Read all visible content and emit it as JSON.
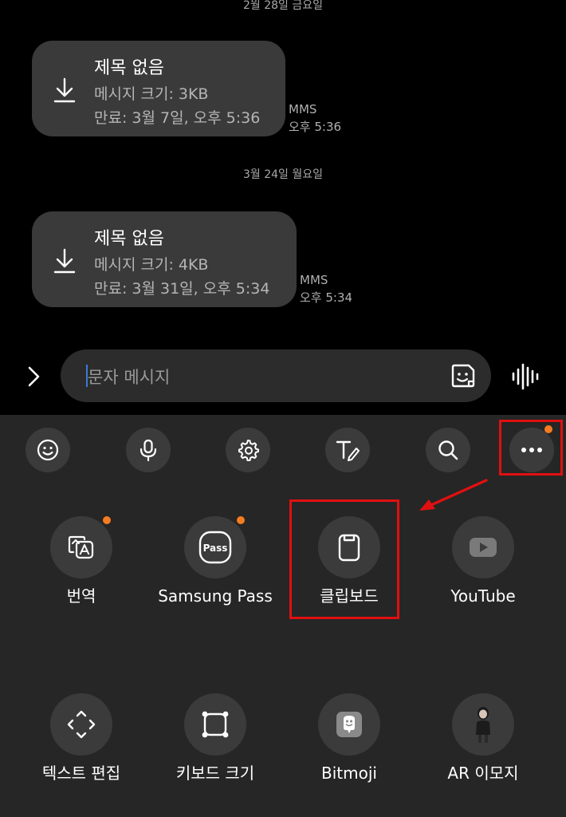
{
  "messages": [
    {
      "date": "2월 28일 금요일",
      "title": "제목 없음",
      "size": "메시지 크기: 3KB",
      "expiry": "만료: 3월 7일, 오후 5:36",
      "type": "MMS",
      "time": "오후 5:36"
    },
    {
      "date": "3월 24일 월요일",
      "title": "제목 없음",
      "size": "메시지 크기: 4KB",
      "expiry": "만료: 3월 31일, 오후 5:34",
      "type": "MMS",
      "time": "오후 5:34"
    }
  ],
  "composer": {
    "placeholder": "문자 메시지"
  },
  "toolbar": {
    "icons": [
      "emoji-icon",
      "mic-icon",
      "gear-icon",
      "handwriting-icon",
      "search-icon",
      "more-icon"
    ]
  },
  "apps": [
    {
      "label": "번역",
      "icon": "translate-icon",
      "badge": true
    },
    {
      "label": "Samsung Pass",
      "icon": "samsung-pass-icon",
      "badge": true
    },
    {
      "label": "클립보드",
      "icon": "clipboard-icon",
      "badge": false
    },
    {
      "label": "YouTube",
      "icon": "youtube-icon",
      "badge": false
    },
    {
      "label": "텍스트 편집",
      "icon": "text-edit-icon",
      "badge": false
    },
    {
      "label": "키보드 크기",
      "icon": "keyboard-size-icon",
      "badge": false
    },
    {
      "label": "Bitmoji",
      "icon": "bitmoji-icon",
      "badge": false
    },
    {
      "label": "AR 이모지",
      "icon": "ar-emoji-icon",
      "badge": false
    }
  ],
  "colors": {
    "badge": "#f57c20",
    "highlight": "#e01010",
    "cursor": "#3a7bd5"
  }
}
